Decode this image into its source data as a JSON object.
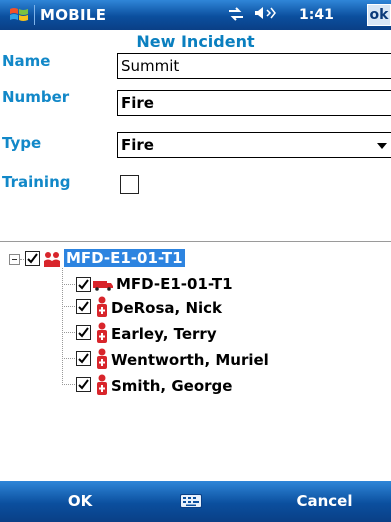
{
  "titlebar": {
    "app_title": "MOBILE",
    "time": "1:41",
    "ok_label": "ok"
  },
  "form": {
    "heading": "New Incident",
    "name_label": "Name",
    "name_value": "Summit",
    "number_label": "Number",
    "number_value": "Fire",
    "type_label": "Type",
    "type_value": "Fire",
    "training_label": "Training",
    "training_checked": false
  },
  "tree": {
    "root": {
      "label": "MFD-E1-01-T1",
      "checked": true,
      "selected": true
    },
    "children": [
      {
        "label": "MFD-E1-01-T1",
        "checked": true,
        "icon": "truck-icon"
      },
      {
        "label": "DeRosa, Nick",
        "checked": true,
        "icon": "firefighter-icon"
      },
      {
        "label": "Earley, Terry",
        "checked": true,
        "icon": "firefighter-icon"
      },
      {
        "label": "Wentworth, Muriel",
        "checked": true,
        "icon": "firefighter-icon"
      },
      {
        "label": "Smith, George",
        "checked": true,
        "icon": "firefighter-icon"
      }
    ]
  },
  "softkeys": {
    "left": "OK",
    "right": "Cancel"
  },
  "colors": {
    "bar_blue": "#0b4f9e",
    "label_blue": "#1288c8",
    "selection": "#2d84e0",
    "icon_red": "#d8252b"
  }
}
